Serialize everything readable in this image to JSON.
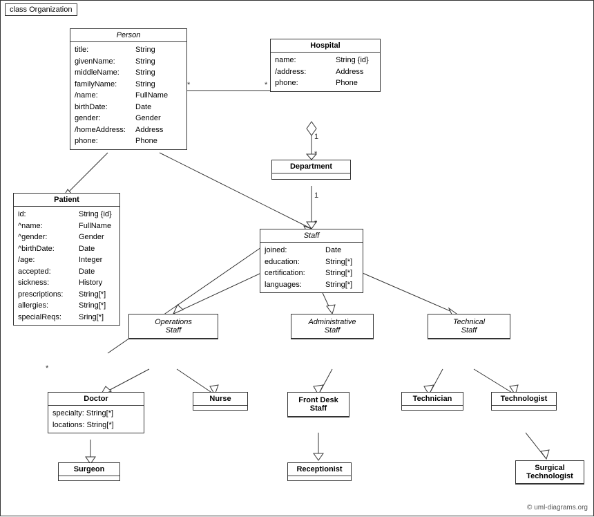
{
  "diagram": {
    "title": "class Organization",
    "classes": {
      "person": {
        "name": "Person",
        "italic": true,
        "attrs": [
          [
            "title:",
            "String"
          ],
          [
            "givenName:",
            "String"
          ],
          [
            "middleName:",
            "String"
          ],
          [
            "familyName:",
            "String"
          ],
          [
            "/name:",
            "FullName"
          ],
          [
            "birthDate:",
            "Date"
          ],
          [
            "gender:",
            "Gender"
          ],
          [
            "/homeAddress:",
            "Address"
          ],
          [
            "phone:",
            "Phone"
          ]
        ]
      },
      "hospital": {
        "name": "Hospital",
        "italic": false,
        "bold": true,
        "attrs": [
          [
            "name:",
            "String {id}"
          ],
          [
            "/address:",
            "Address"
          ],
          [
            "phone:",
            "Phone"
          ]
        ]
      },
      "patient": {
        "name": "Patient",
        "italic": false,
        "bold": true,
        "attrs": [
          [
            "id:",
            "String {id}"
          ],
          [
            "^name:",
            "FullName"
          ],
          [
            "^gender:",
            "Gender"
          ],
          [
            "^birthDate:",
            "Date"
          ],
          [
            "/age:",
            "Integer"
          ],
          [
            "accepted:",
            "Date"
          ],
          [
            "sickness:",
            "History"
          ],
          [
            "prescriptions:",
            "String[*]"
          ],
          [
            "allergies:",
            "String[*]"
          ],
          [
            "specialReqs:",
            "Sring[*]"
          ]
        ]
      },
      "department": {
        "name": "Department",
        "italic": false,
        "bold": true,
        "attrs": []
      },
      "staff": {
        "name": "Staff",
        "italic": true,
        "attrs": [
          [
            "joined:",
            "Date"
          ],
          [
            "education:",
            "String[*]"
          ],
          [
            "certification:",
            "String[*]"
          ],
          [
            "languages:",
            "String[*]"
          ]
        ]
      },
      "operations_staff": {
        "name": "Operations Staff",
        "italic": true,
        "attrs": []
      },
      "administrative_staff": {
        "name": "Administrative Staff",
        "italic": true,
        "attrs": []
      },
      "technical_staff": {
        "name": "Technical Staff",
        "italic": true,
        "attrs": []
      },
      "doctor": {
        "name": "Doctor",
        "italic": false,
        "bold": true,
        "attrs": [
          [
            "specialty:",
            "String[*]"
          ],
          [
            "locations:",
            "String[*]"
          ]
        ]
      },
      "nurse": {
        "name": "Nurse",
        "italic": false,
        "bold": true,
        "attrs": []
      },
      "front_desk_staff": {
        "name": "Front Desk Staff",
        "italic": false,
        "bold": true,
        "attrs": []
      },
      "technician": {
        "name": "Technician",
        "italic": false,
        "bold": true,
        "attrs": []
      },
      "technologist": {
        "name": "Technologist",
        "italic": false,
        "bold": true,
        "attrs": []
      },
      "surgeon": {
        "name": "Surgeon",
        "italic": false,
        "bold": true,
        "attrs": []
      },
      "receptionist": {
        "name": "Receptionist",
        "italic": false,
        "bold": true,
        "attrs": []
      },
      "surgical_technologist": {
        "name": "Surgical Technologist",
        "italic": false,
        "bold": true,
        "attrs": []
      }
    },
    "copyright": "© uml-diagrams.org"
  }
}
